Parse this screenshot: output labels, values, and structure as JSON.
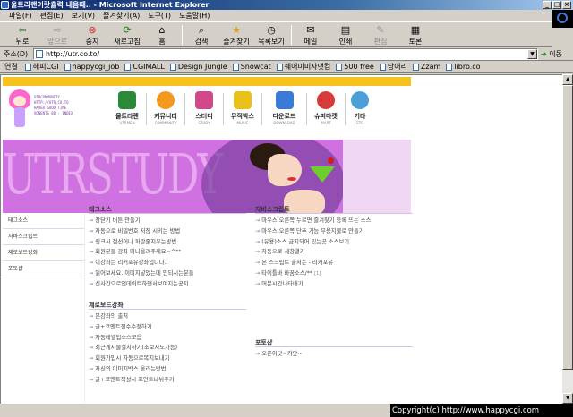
{
  "window": {
    "title": "울트라랜어랏츌력 내음때.. - Microsoft Internet Explorer",
    "controls": [
      "_",
      "□",
      "×"
    ]
  },
  "menu": [
    "파일(F)",
    "편집(E)",
    "보기(V)",
    "즐겨찾기(A)",
    "도구(T)",
    "도움말(H)"
  ],
  "toolbar": [
    {
      "label": "뒤로",
      "icon": "back-arrow-icon",
      "glyph": "⇦",
      "disabled": false
    },
    {
      "label": "앞으로",
      "icon": "forward-arrow-icon",
      "glyph": "⇨",
      "disabled": true
    },
    {
      "label": "중지",
      "icon": "stop-icon",
      "glyph": "⊗",
      "disabled": false
    },
    {
      "label": "새로고침",
      "icon": "refresh-icon",
      "glyph": "⟳",
      "disabled": false
    },
    {
      "label": "홈",
      "icon": "home-icon",
      "glyph": "⌂",
      "disabled": false
    },
    {
      "label": "검색",
      "icon": "search-icon",
      "glyph": "⌕",
      "disabled": false
    },
    {
      "label": "즐겨찾기",
      "icon": "favorites-icon",
      "glyph": "★",
      "disabled": false
    },
    {
      "label": "목록보기",
      "icon": "history-icon",
      "glyph": "◷",
      "disabled": false
    },
    {
      "label": "메일",
      "icon": "mail-icon",
      "glyph": "✉",
      "disabled": false
    },
    {
      "label": "인쇄",
      "icon": "print-icon",
      "glyph": "▤",
      "disabled": false
    },
    {
      "label": "편집",
      "icon": "edit-icon",
      "glyph": "✎",
      "disabled": true
    },
    {
      "label": "토론",
      "icon": "discuss-icon",
      "glyph": "▦",
      "disabled": false
    }
  ],
  "address": {
    "label": "주소(D)",
    "value": "http://utr.co.to/",
    "go_label": "이동"
  },
  "links": {
    "label": "연결",
    "items": [
      "해피CGI",
      "happycgi_job",
      "CGIMALL",
      "Design Jungle",
      "Snowcat",
      "쉐어미미자댓컴",
      "500 free",
      "당어리",
      "Zzam",
      "libro.co"
    ]
  },
  "site": {
    "logo_text": [
      "UTRCOMMUNITY",
      "HTTP://UTR.CO.TO",
      "HAVER GOOD TIME",
      "XONENTS 88 - INDEX"
    ],
    "nav": [
      {
        "label": "울트라랜",
        "sub": "UTRMEN",
        "color": "#2a8a3a"
      },
      {
        "label": "커뮤니티",
        "sub": "COMMUNITY",
        "color": "#f39a1e"
      },
      {
        "label": "스터디",
        "sub": "STUDY",
        "color": "#d04a8a"
      },
      {
        "label": "뮤직박스",
        "sub": "MUSIC",
        "color": "#e8c01a"
      },
      {
        "label": "다운로드",
        "sub": "DOWNLOAD",
        "color": "#3a7bd5"
      },
      {
        "label": "슈퍼마켓",
        "sub": "MART",
        "color": "#d83a3a"
      },
      {
        "label": "기타",
        "sub": "ETC",
        "color": "#4a9fd8"
      }
    ],
    "banner_text": "UTRSTUDY",
    "left_menu": [
      "태그소스",
      "자바스크립트",
      "제로보드강좌",
      "포토샵"
    ],
    "sections": {
      "tag": {
        "title": "태그소스",
        "items": [
          "창닫기 버튼 만들기",
          "자동으로 비밀번호 저장 시키는 방법",
          "링크시 점선이나 파란줄지우는방법",
          "회원분들 강좌 미니올려주세요~^**",
          "이강좌는 리커포유강좌입니다..",
          "읽어보세요..이미지넣었는데 안되시는분들",
          "신사간으로업데이트하면서보여지는공지"
        ]
      },
      "js": {
        "title": "자바스크립트",
        "items": [
          "마우스 오른쪽 누르면 즐겨찾기 등록 뜨는 소스",
          "마우스 오른쪽 단추 기능 무용지물로 만들기",
          "(유용)소스 금지되어 있는곳 소스보기",
          "자동으로 새창열기",
          "본 스크립트 출처는 - 리커포유",
          "타이틀바 바꿈소스/**",
          "머문시간나타내기"
        ],
        "tag": "[1]"
      },
      "zb": {
        "title": "제로보드강좌",
        "items": [
          "본강좌의 출처",
          "글+코멘트점수수정하기",
          "자동레벨업소스모음",
          "최근게시물설치하기(초보자도가능)",
          "회원가입시 자동으로목지보내기",
          "자신의 이미지박스 올리는방법",
          "글+코멘트작성시 포인트나뉘주기"
        ]
      },
      "ps": {
        "title": "포토샵",
        "items": [
          "오픈이닷~캬앗~"
        ]
      }
    }
  },
  "status": {
    "copyright": "Copyright(c) http://www.happycgi.com"
  }
}
